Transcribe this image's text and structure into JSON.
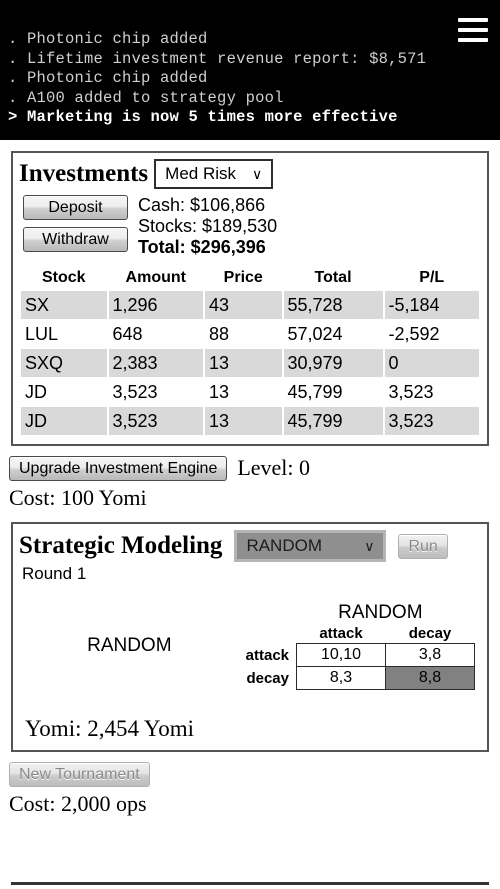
{
  "console": {
    "lines": [
      {
        "prefix": ".",
        "text": "Photonic chip added",
        "current": false
      },
      {
        "prefix": ".",
        "text": "Lifetime investment revenue report: $8,571",
        "current": false
      },
      {
        "prefix": ".",
        "text": "Photonic chip added",
        "current": false
      },
      {
        "prefix": ".",
        "text": "A100 added to strategy pool",
        "current": false
      },
      {
        "prefix": ">",
        "text": "Marketing is now 5 times more effective",
        "current": true
      }
    ],
    "menu_icon": "hamburger-menu-icon"
  },
  "investments": {
    "title": "Investments",
    "risk_select": {
      "value": "Med Risk",
      "chevron": "∨"
    },
    "deposit_label": "Deposit",
    "withdraw_label": "Withdraw",
    "cash_label": "Cash:",
    "cash_value": "$106,866",
    "stocks_label": "Stocks:",
    "stocks_value": "$189,530",
    "total_label": "Total:",
    "total_value": "$296,396",
    "table": {
      "headers": [
        "Stock",
        "Amount",
        "Price",
        "Total",
        "P/L"
      ],
      "rows": [
        [
          "SX",
          "1,296",
          "43",
          "55,728",
          "-5,184"
        ],
        [
          "LUL",
          "648",
          "88",
          "57,024",
          "-2,592"
        ],
        [
          "SXQ",
          "2,383",
          "13",
          "30,979",
          "0"
        ],
        [
          "JD",
          "3,523",
          "13",
          "45,799",
          "3,523"
        ],
        [
          "JD",
          "3,523",
          "13",
          "45,799",
          "3,523"
        ]
      ]
    },
    "upgrade_button": "Upgrade Investment Engine",
    "level_text": "Level: 0",
    "cost_text": "Cost: 100 Yomi"
  },
  "strategic_modeling": {
    "title": "Strategic Modeling",
    "opponent_select": {
      "value": "RANDOM",
      "chevron": "∨"
    },
    "run_label": "Run",
    "round_text": "Round 1",
    "row_player": "RANDOM",
    "col_player": "RANDOM",
    "matrix": {
      "col_headers": [
        "attack",
        "decay"
      ],
      "row_headers": [
        "attack",
        "decay"
      ],
      "cells": [
        [
          {
            "value": "10,10",
            "highlight": false
          },
          {
            "value": "3,8",
            "highlight": false
          }
        ],
        [
          {
            "value": "8,3",
            "highlight": false
          },
          {
            "value": "8,8",
            "highlight": true
          }
        ]
      ]
    },
    "yomi_label": "Yomi:",
    "yomi_value": "2,454 Yomi",
    "new_tournament_button": "New Tournament",
    "tournament_cost": "Cost: 2,000 ops"
  },
  "colors": {
    "console_bg": "#000000",
    "console_text": "#cfcfcf",
    "console_current": "#ffffff",
    "panel_border": "#555555",
    "row_stripe": "#d9d9d9",
    "matrix_highlight": "#818181",
    "select_gray": "#8f8f8f"
  }
}
